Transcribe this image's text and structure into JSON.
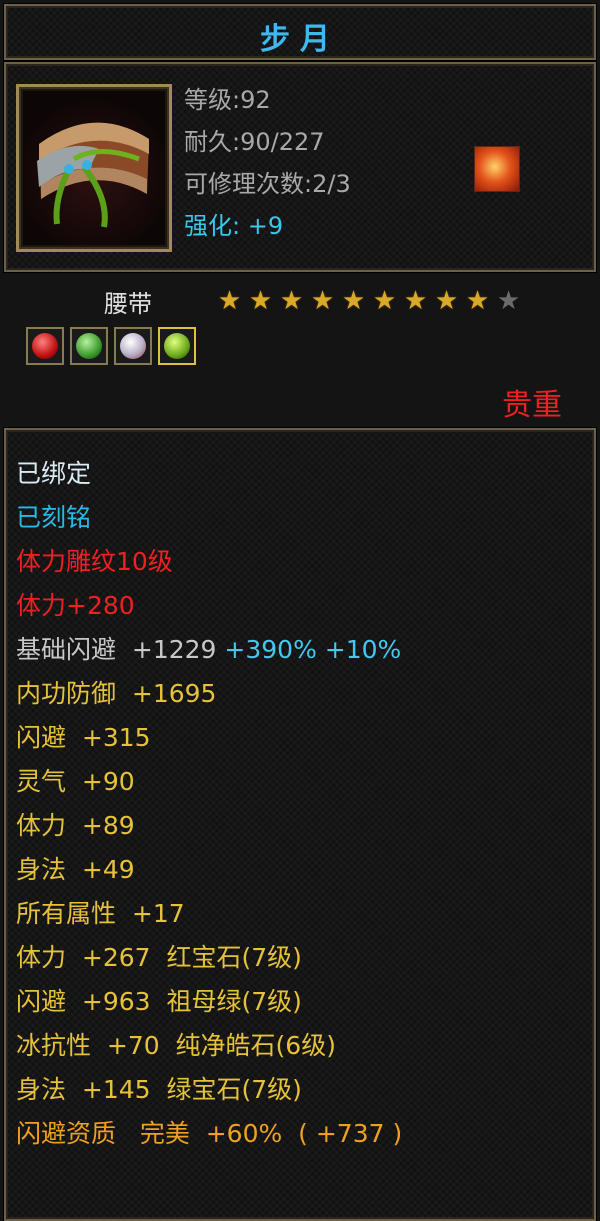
{
  "title": "步月",
  "item": {
    "level": "等级:92",
    "durability": "耐久:90/227",
    "repair": "可修理次数:2/3",
    "enhance": "强化: +9"
  },
  "type_label": "腰带",
  "stars": {
    "filled": 9,
    "total": 10
  },
  "gems": [
    "red-gem-icon",
    "green-gem-icon",
    "white-gem-icon",
    "emerald-gem-icon"
  ],
  "rarity": "贵重",
  "stats": {
    "bound": "已绑定",
    "engraved": "已刻铭",
    "carving": "体力雕纹10级",
    "stamina_bonus": "体力+280",
    "base_dodge": "基础闪避  +1229",
    "base_dodge_pct1": "+390%",
    "base_dodge_pct2": "+10%",
    "inner_def": "内功防御  +1695",
    "dodge": "闪避  +315",
    "spirit": "灵气  +90",
    "stamina": "体力  +89",
    "agility": "身法  +49",
    "all_attr": "所有属性  +17",
    "gem1": "体力  +267  红宝石(7级)",
    "gem2": "闪避  +963  祖母绿(7级)",
    "gem3": "冰抗性  +70  纯净皓石(6级)",
    "gem4": "身法  +145  绿宝石(7级)",
    "quality": "闪避资质   完美  +60%  ( +737 )"
  },
  "colors": {
    "title": "#3fb8ee",
    "rarity": "#ee2020",
    "star": "#d9a92a",
    "frame": "#6b6048"
  }
}
